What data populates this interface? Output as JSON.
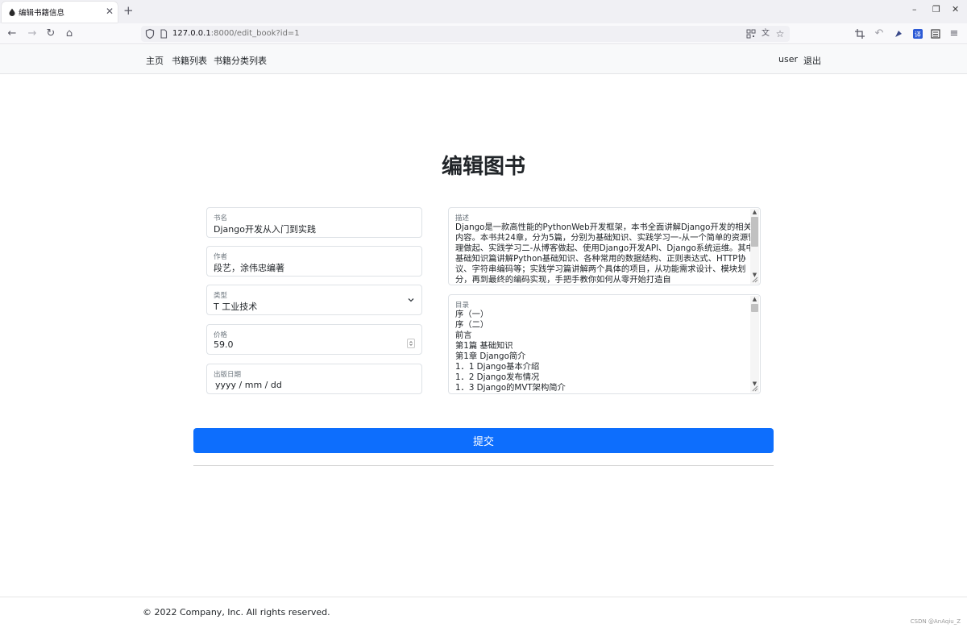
{
  "browser": {
    "tab_title": "编辑书籍信息",
    "url_host": "127.0.0.1",
    "url_rest": ":8000/edit_book?id=1",
    "icons": [
      "back-icon",
      "forward-icon",
      "reload-icon",
      "home-icon",
      "shield-icon",
      "page-icon",
      "qr-icon",
      "translate-icon",
      "star-icon",
      "crop-icon",
      "undo-icon",
      "extension-icon",
      "translate-extension-icon",
      "reader-icon",
      "menu-icon"
    ]
  },
  "site_nav": {
    "home": "主页",
    "book_list": "书籍列表",
    "category_list": "书籍分类列表",
    "user": "user",
    "logout": "退出"
  },
  "page": {
    "title": "编辑图书"
  },
  "form": {
    "name_label": "书名",
    "name_value": "Django开发从入门到实践",
    "author_label": "作者",
    "author_value": "段艺，涂伟忠编著",
    "type_label": "类型",
    "type_value": "T 工业技术",
    "price_label": "价格",
    "price_value": "59.0",
    "date_label": "出版日期",
    "date_placeholder": "yyyy / mm / dd",
    "desc_label": "描述",
    "desc_value": "Django是一款高性能的PythonWeb开发框架，本书全面讲解Django开发的相关内容。本书共24章，分为5篇，分别为基础知识、实践学习一-从一个简单的资源管理做起、实践学习二-从博客做起、使用Django开发API、Django系统运维。其中基础知识篇讲解Python基础知识、各种常用的数据结构、正则表达式、HTTP协议、字符串编码等；实践学习篇讲解两个具体的项目，从功能需求设计、模块划分，再到最终的编码实现，手把手教你如何从零开始打造自",
    "toc_label": "目录",
    "toc_lines": [
      "序（一）",
      "序（二）",
      "前言",
      "第1篇 基础知识",
      "第1章 Django简介",
      "1．1 Django基本介绍",
      "1．2 Django发布情况",
      "1．3 Django的MVT架构简介"
    ],
    "submit_label": "提交"
  },
  "footer": {
    "copyright": "© 2022 Company, Inc. All rights reserved.",
    "watermark": "CSDN @AnAqiu_Z"
  },
  "colors": {
    "primary": "#0d6efd",
    "header_bg": "#f8f9fa",
    "border": "#dee2e6"
  }
}
